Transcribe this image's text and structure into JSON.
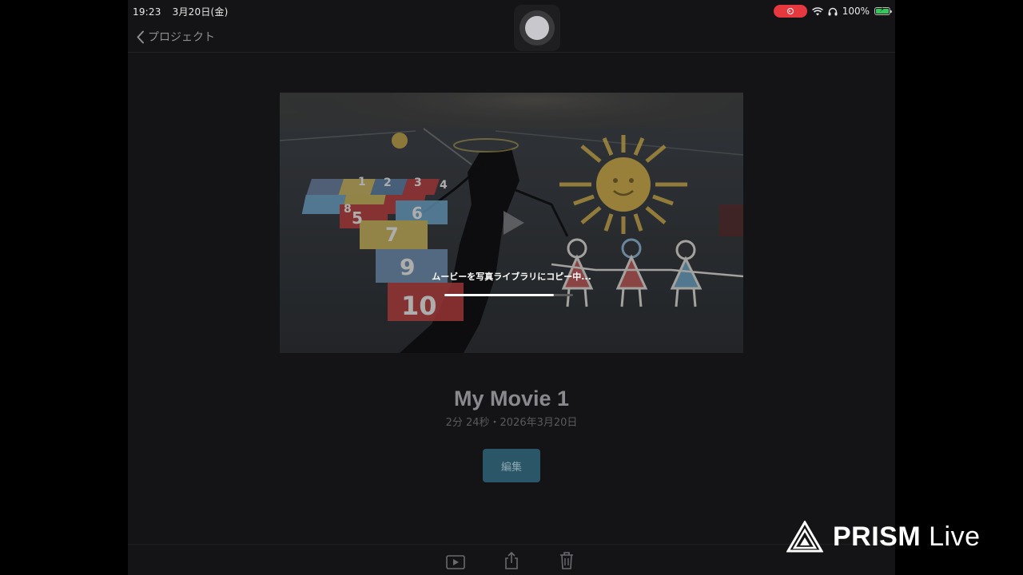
{
  "status_bar": {
    "time": "19:23",
    "date": "3月20日(金)",
    "battery": "100%",
    "recording_color": "#e5393f"
  },
  "nav": {
    "back_label": "プロジェクト"
  },
  "preview": {
    "copy_message": "ムービーを写真ライブラリにコピー中...",
    "progress": 0.85,
    "hopscotch_numbers": [
      "1",
      "2",
      "3",
      "4",
      "5",
      "6",
      "7",
      "8",
      "9",
      "10"
    ]
  },
  "project": {
    "title": "My Movie 1",
    "meta": "2分 24秒・2026年3月20日",
    "edit_label": "編集"
  },
  "toolbar": {
    "icons": [
      "play-icon",
      "share-icon",
      "trash-icon"
    ]
  },
  "watermark": {
    "brand": "PRISM",
    "suffix": "Live"
  },
  "colors": {
    "accent": "#2a5668",
    "background": "#141416"
  }
}
